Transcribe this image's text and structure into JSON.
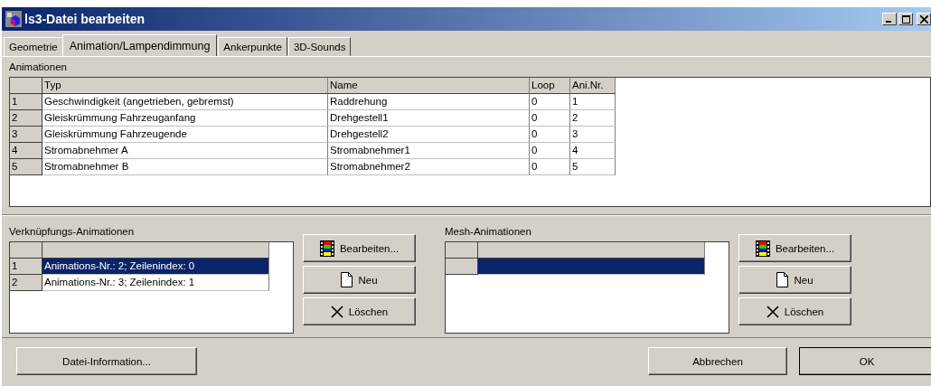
{
  "window": {
    "title": "ls3-Datei bearbeiten"
  },
  "tabs": [
    {
      "label": "Geometrie",
      "selected": false
    },
    {
      "label": "Animation/Lampendimmung",
      "selected": true
    },
    {
      "label": "Ankerpunkte",
      "selected": false
    },
    {
      "label": "3D-Sounds",
      "selected": false
    }
  ],
  "animations": {
    "label": "Animationen",
    "columns": [
      "Typ",
      "Name",
      "Loop",
      "Ani.Nr."
    ],
    "rows": [
      {
        "number": "1",
        "cells": [
          "Geschwindigkeit (angetrieben, gebremst)",
          "Raddrehung",
          "0",
          "1"
        ]
      },
      {
        "number": "2",
        "cells": [
          "Gleiskrümmung Fahrzeuganfang",
          "Drehgestell1",
          "0",
          "2"
        ]
      },
      {
        "number": "3",
        "cells": [
          "Gleiskrümmung Fahrzeugende",
          "Drehgestell2",
          "0",
          "3"
        ]
      },
      {
        "number": "4",
        "cells": [
          "Stromabnehmer A",
          "Stromabnehmer1",
          "0",
          "4"
        ]
      },
      {
        "number": "5",
        "cells": [
          "Stromabnehmer B",
          "Stromabnehmer2",
          "0",
          "5"
        ]
      }
    ]
  },
  "link_animations": {
    "label": "Verknüpfungs-Animationen",
    "rows": [
      {
        "number": "1",
        "text": "Animations-Nr.: 2; Zeilenindex: 0",
        "selected": true
      },
      {
        "number": "2",
        "text": "Animations-Nr.: 3; Zeilenindex: 1",
        "selected": false
      }
    ],
    "buttons": [
      {
        "kind": "edit",
        "label": "Bearbeiten..."
      },
      {
        "kind": "new",
        "label": "Neu"
      },
      {
        "kind": "delete",
        "label": "Löschen"
      }
    ]
  },
  "mesh_animations": {
    "label": "Mesh-Animationen",
    "rows": [
      {
        "selected": true
      }
    ],
    "buttons": [
      {
        "kind": "edit",
        "label": "Bearbeiten..."
      },
      {
        "kind": "new",
        "label": "Neu"
      },
      {
        "kind": "delete",
        "label": "Löschen"
      }
    ]
  },
  "footer_buttons": {
    "info": "Datei-Information...",
    "cancel": "Abbrechen",
    "ok": "OK"
  }
}
